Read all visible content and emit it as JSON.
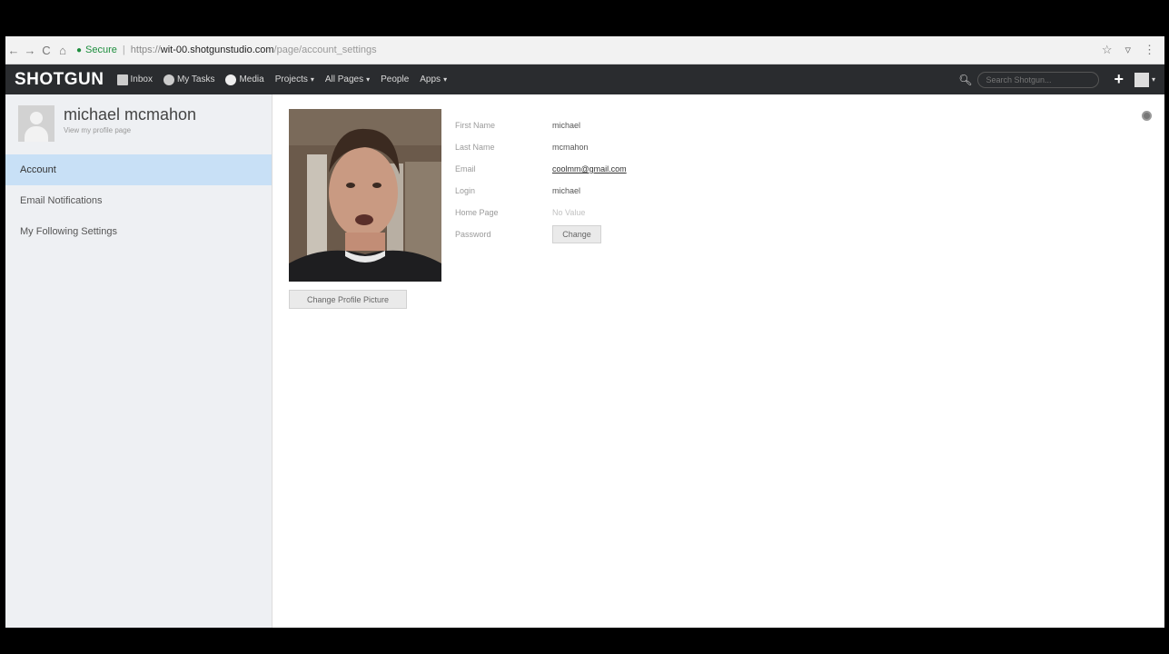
{
  "browser": {
    "back": "←",
    "forward": "→",
    "reload": "C",
    "home": "⌂",
    "secure_label": "Secure",
    "url_proto": "https://",
    "url_host": "wit-00.shotgunstudio.com",
    "url_path": "/page/account_settings",
    "star_icon": "☆",
    "ext_icon": "▿",
    "menu_icon": "⋮"
  },
  "nav": {
    "logo": "SHOTGUN",
    "items": [
      {
        "label": "Inbox",
        "icon": "inbox-icon"
      },
      {
        "label": "My Tasks",
        "icon": "check-circle-icon"
      },
      {
        "label": "Media",
        "icon": "play-circle-icon"
      },
      {
        "label": "Projects",
        "dropdown": true
      },
      {
        "label": "All Pages",
        "dropdown": true
      },
      {
        "label": "People",
        "dropdown": false
      },
      {
        "label": "Apps",
        "dropdown": true
      }
    ],
    "caret": "▾",
    "search_placeholder": "Search Shotgun...",
    "plus": "+"
  },
  "sidebar": {
    "name": "michael mcmahon",
    "profile_link": "View my profile page",
    "items": [
      {
        "label": "Account",
        "active": true
      },
      {
        "label": "Email Notifications",
        "active": false
      },
      {
        "label": "My Following Settings",
        "active": false
      }
    ]
  },
  "profile": {
    "change_picture": "Change Profile Picture",
    "fields": [
      {
        "label": "First Name",
        "value": "michael"
      },
      {
        "label": "Last Name",
        "value": "mcmahon"
      },
      {
        "label": "Email",
        "value": "coolmm@gmail.com"
      },
      {
        "label": "Login",
        "value": "michael"
      },
      {
        "label": "Home Page",
        "value": "No Value"
      },
      {
        "label": "Password",
        "value": "Change"
      }
    ]
  },
  "colors": {
    "nav_bg": "#2a2c2f",
    "sidebar_bg": "#eef0f3",
    "active_item": "#c8e0f6"
  }
}
